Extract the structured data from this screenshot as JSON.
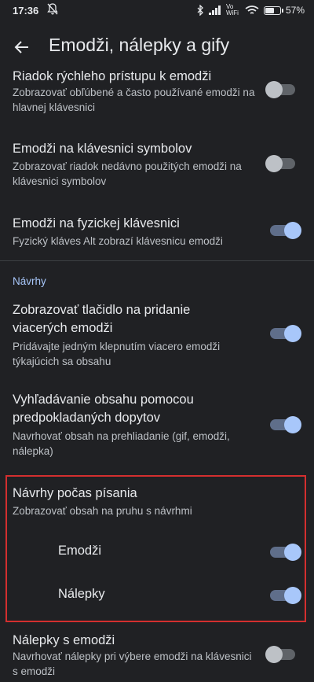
{
  "status_bar": {
    "time": "17:36",
    "network_label": "Vo WiFi",
    "battery_text": "57%",
    "battery_level": 0.57
  },
  "app_bar": {
    "title": "Emodži, nálepky a gify"
  },
  "settings": [
    {
      "title": "Riadok rýchleho prístupu k emodži",
      "summary": "Zobrazovať obľúbené a často používané emodži na hlavnej klávesnici",
      "enabled": false
    },
    {
      "title": "Emodži na klávesnici symbolov",
      "summary": "Zobrazovať riadok nedávno použitých emodži na klávesnici symbolov",
      "enabled": false
    },
    {
      "title": "Emodži na fyzickej klávesnici",
      "summary": "Fyzický kláves Alt zobrazí klávesnicu emodži",
      "enabled": true
    }
  ],
  "category": "Návrhy",
  "suggestions": [
    {
      "title": "Zobrazovať tlačidlo na pridanie viacerých emodži",
      "summary": "Pridávajte jedným klepnutím viacero emodži týkajúcich sa obsahu",
      "enabled": true
    },
    {
      "title": "Vyhľadávanie obsahu pomocou predpokladaných dopytov",
      "summary": "Navrhovať obsah na prehliadanie (gif, emodži, nálepka)",
      "enabled": true
    }
  ],
  "typing_suggestions": {
    "title": "Návrhy počas písania",
    "summary": "Zobrazovať obsah na pruhu s návrhmi",
    "items": [
      {
        "label": "Emodži",
        "enabled": true
      },
      {
        "label": "Nálepky",
        "enabled": true
      }
    ]
  },
  "sticker_setting": {
    "title": "Nálepky s emodži",
    "summary": "Navrhovať nálepky pri výbere emodži na klávesnici s emodži",
    "enabled": false
  },
  "colors": {
    "background": "#202124",
    "accent": "#a8c7fa",
    "highlight": "#d32f2f"
  }
}
